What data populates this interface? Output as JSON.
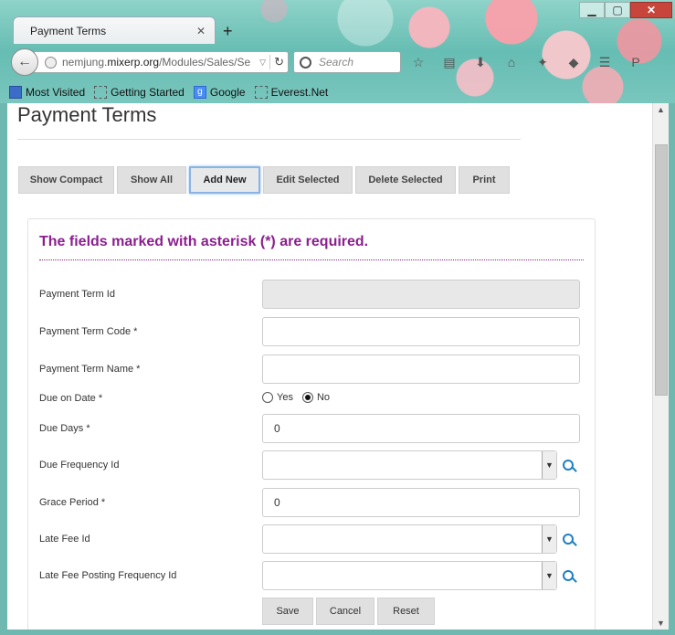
{
  "browser": {
    "tab_title": "Payment Terms",
    "tab_close": "✕",
    "new_tab": "+",
    "url_host": "nemjung.",
    "url_domain": "mixerp.org",
    "url_path": "/Modules/Sales/Se",
    "search_placeholder": "Search",
    "window_min": "▁",
    "window_max": "▢",
    "window_close": "✕",
    "bookmarks": [
      "Most Visited",
      "Getting Started",
      "Google",
      "Everest.Net"
    ]
  },
  "page": {
    "title": "Payment Terms",
    "toolbar": [
      "Show Compact",
      "Show All",
      "Add New",
      "Edit Selected",
      "Delete Selected",
      "Print"
    ],
    "active_toolbar": "Add New",
    "form": {
      "heading": "The fields marked with asterisk (*) are required.",
      "labels": {
        "payment_term_id": "Payment Term Id",
        "payment_term_code": "Payment Term Code *",
        "payment_term_name": "Payment Term Name *",
        "due_on_date": "Due on Date *",
        "due_days": "Due Days *",
        "due_frequency_id": "Due Frequency Id",
        "grace_period": "Grace Period *",
        "late_fee_id": "Late Fee Id",
        "late_fee_posting_frequency_id": "Late Fee Posting Frequency Id"
      },
      "values": {
        "payment_term_id": "",
        "payment_term_code": "",
        "payment_term_name": "",
        "due_days": "0",
        "due_frequency_id": "",
        "grace_period": "0",
        "late_fee_id": "",
        "late_fee_posting_frequency_id": ""
      },
      "due_on_date_options": [
        "Yes",
        "No"
      ],
      "due_on_date_selected": "No",
      "buttons": {
        "save": "Save",
        "cancel": "Cancel",
        "reset": "Reset"
      }
    }
  },
  "colors": {
    "heading": "#8b1f8e",
    "lookup": "#1f7fc4",
    "active_border": "#8ab4e6"
  }
}
